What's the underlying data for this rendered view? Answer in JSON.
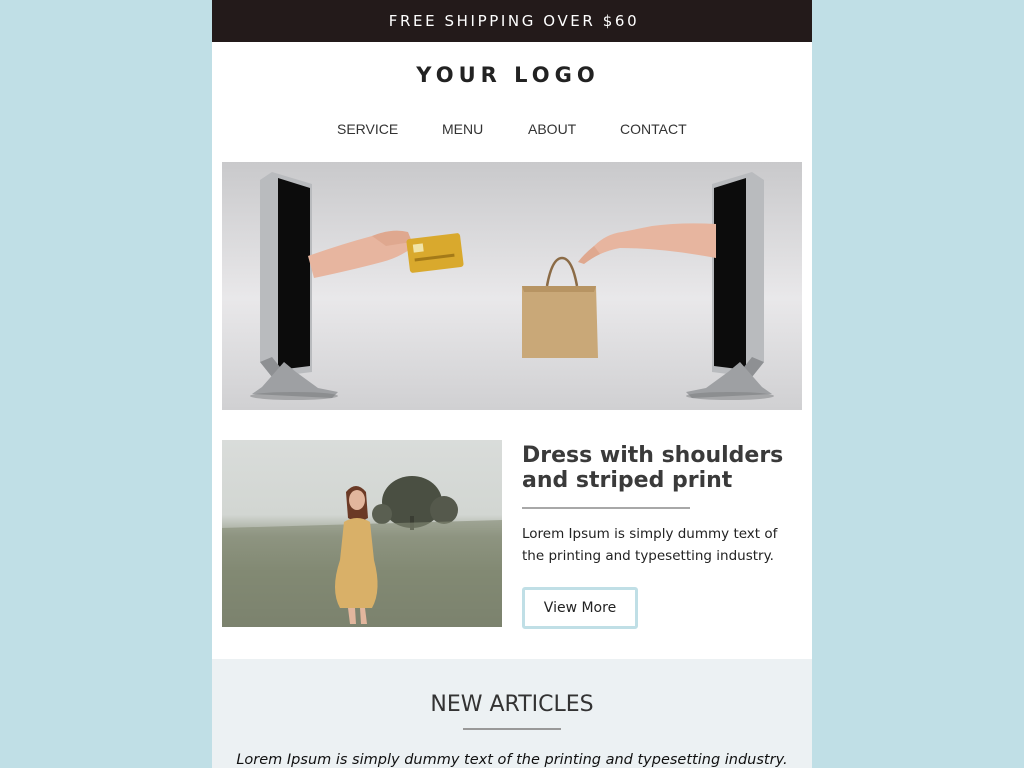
{
  "topbar": {
    "text": "FREE SHIPPING OVER $60"
  },
  "logo": {
    "text": "YOUR LOGO"
  },
  "nav": {
    "items": [
      {
        "label": "SERVICE"
      },
      {
        "label": "MENU"
      },
      {
        "label": "ABOUT"
      },
      {
        "label": "CONTACT"
      }
    ]
  },
  "hero": {
    "image": "online-shopping-monitors-card-bag"
  },
  "product": {
    "image": "woman-in-dress-in-field",
    "title": "Dress with shoulders and striped print",
    "description": "Lorem Ipsum is simply dummy text of the printing and typesetting industry.",
    "button_label": "View More"
  },
  "articles": {
    "title": "NEW ARTICLES",
    "description": "Lorem Ipsum is simply dummy text of the printing and typesetting industry."
  },
  "colors": {
    "page_background": "#c0dfe6",
    "topbar_background": "#231a1a",
    "articles_background": "#ecf1f3",
    "button_border": "#c0dfe6"
  }
}
